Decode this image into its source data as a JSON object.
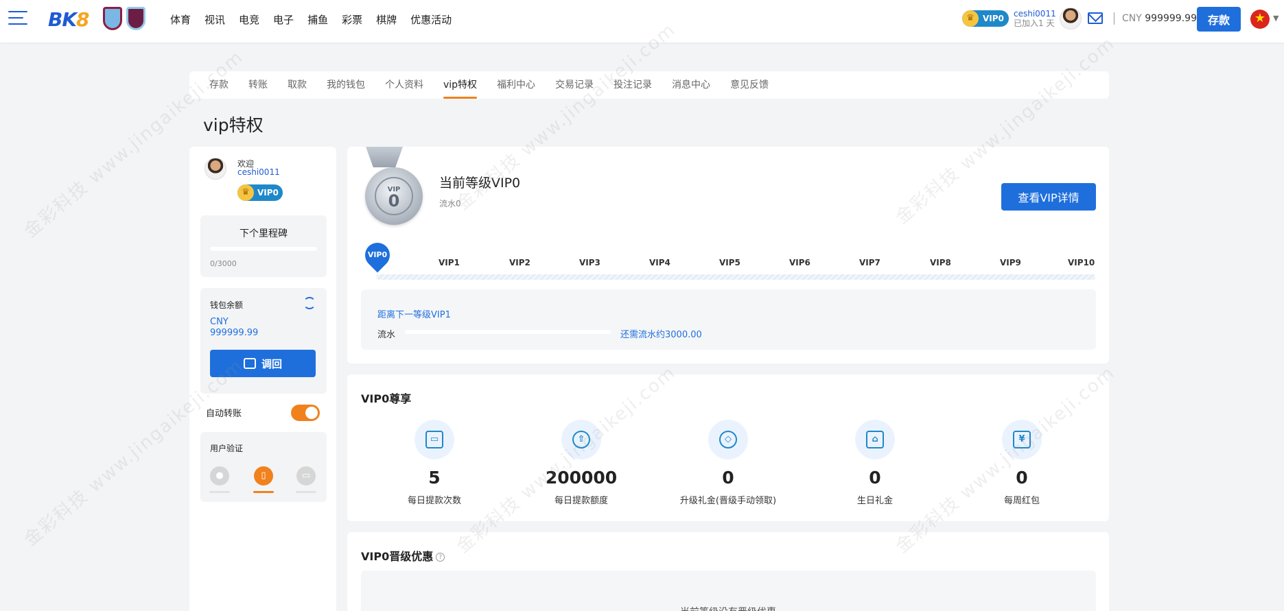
{
  "header": {
    "logo_main": "BK",
    "logo_eight": "8",
    "nav": [
      "体育",
      "视讯",
      "电竞",
      "电子",
      "捕鱼",
      "彩票",
      "棋牌",
      "优惠活动"
    ],
    "vip_level": "VIP0",
    "username": "ceshi0011",
    "joined": "已加入1 天",
    "currency": "CNY",
    "balance": "999999.99",
    "deposit_label": "存款",
    "flag_glyph": "★"
  },
  "tabs": [
    "存款",
    "转账",
    "取款",
    "我的钱包",
    "个人资料",
    "vip特权",
    "福利中心",
    "交易记录",
    "投注记录",
    "消息中心",
    "意见反馈"
  ],
  "active_tab": "vip特权",
  "page_title": "vip特权",
  "sidebar": {
    "welcome": "欢迎",
    "username": "ceshi0011",
    "vip_level": "VIP0",
    "milestone_title": "下个里程碑",
    "milestone_progress": "0/3000",
    "milestone_fraction": 0,
    "wallet_label": "钱包余额",
    "wallet_currency": "CNY",
    "wallet_amount": "999999.99",
    "recall_label": "调回",
    "auto_transfer_label": "自动转账",
    "auto_transfer_on": true,
    "verify_label": "用户验证"
  },
  "level_panel": {
    "medal_vip": "VIP",
    "medal_level": "0",
    "current_level": "当前等级VIP0",
    "flow": "流水0",
    "detail_button": "查看VIP详情",
    "current_marker": "VIP0",
    "levels": [
      "VIP1",
      "VIP2",
      "VIP3",
      "VIP4",
      "VIP5",
      "VIP6",
      "VIP7",
      "VIP8",
      "VIP9",
      "VIP10"
    ],
    "next_title": "距离下一等级VIP1",
    "next_flow_label": "流水",
    "next_flow_fraction": 0,
    "next_remaining": "还需流水约3000.00"
  },
  "perks": {
    "title": "VIP0尊享",
    "items": [
      {
        "value": "5",
        "name": "每日提款次数",
        "icon": "card-icon"
      },
      {
        "value": "200000",
        "name": "每日提款额度",
        "icon": "upload-icon"
      },
      {
        "value": "0",
        "name": "升级礼金(晋级手动领取)",
        "icon": "diamond-icon"
      },
      {
        "value": "0",
        "name": "生日礼金",
        "icon": "cake-icon"
      },
      {
        "value": "0",
        "name": "每周红包",
        "icon": "red-envelope-icon"
      }
    ]
  },
  "promo": {
    "title": "VIP0晋级优惠",
    "help": "?",
    "empty_text": "当前等级没有晋级优惠"
  },
  "watermark": "金彩科技 www.jingaikeji.com",
  "colors": {
    "primary": "#1e6fdc",
    "accent": "#f0811d",
    "vip_badge": "#1e88c9"
  }
}
